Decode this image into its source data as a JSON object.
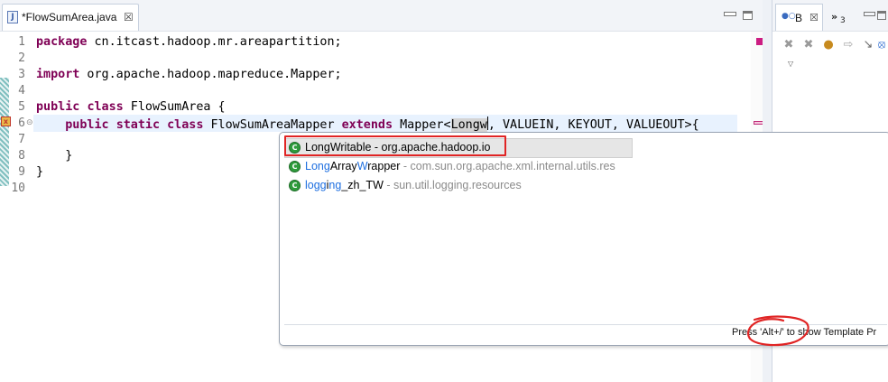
{
  "editor": {
    "tab": {
      "title": "*FlowSumArea.java",
      "close": "☒"
    },
    "line_numbers": [
      "1",
      "2",
      "3",
      "4",
      "5",
      "6",
      "7",
      "8",
      "9",
      "10"
    ],
    "code": {
      "l1_kw": "package",
      "l1_rest": " cn.itcast.hadoop.mr.areapartition;",
      "l3_kw": "import",
      "l3_rest": " org.apache.hadoop.mapreduce.Mapper;",
      "l5_kw1": "public",
      "l5_kw2": "class",
      "l5_rest": " FlowSumArea {",
      "l6_indent": "    ",
      "l6_kw1": "public",
      "l6_kw2": "static",
      "l6_kw3": "class",
      "l6_name": " FlowSumAreaMapper ",
      "l6_kw4": "extends",
      "l6_mapper": " Mapper<",
      "l6_typed": "Longw",
      "l6_rest": ", VALUEIN, KEYOUT, VALUEOUT>{",
      "l8": "    }",
      "l9": "}"
    }
  },
  "content_assist": {
    "proposals": [
      {
        "match": "Long",
        "mid": "Writable",
        "match2": "",
        "tail": "",
        "package": " - org.apache.hadoop.io",
        "selected": true
      },
      {
        "match": "Long",
        "mid": "Array",
        "match2": "W",
        "tail": "rapper",
        "package": " - com.sun.org.apache.xml.internal.utils.res",
        "selected": false
      },
      {
        "match": "logg",
        "mid": "i",
        "match2": "ng",
        "tail": "_zh_TW",
        "package": " - sun.util.logging.resources",
        "selected": false
      }
    ],
    "status": "Press 'Alt+/' to show Template Pr"
  },
  "side_view": {
    "tab_label": "B",
    "tab_close": "☒",
    "more": "»",
    "more_count": "3"
  },
  "colors": {
    "keyword": "#7f0055",
    "current_line": "#e8f2fe",
    "match_highlight": "#1e6fe0",
    "annotation_red": "#e02424"
  }
}
